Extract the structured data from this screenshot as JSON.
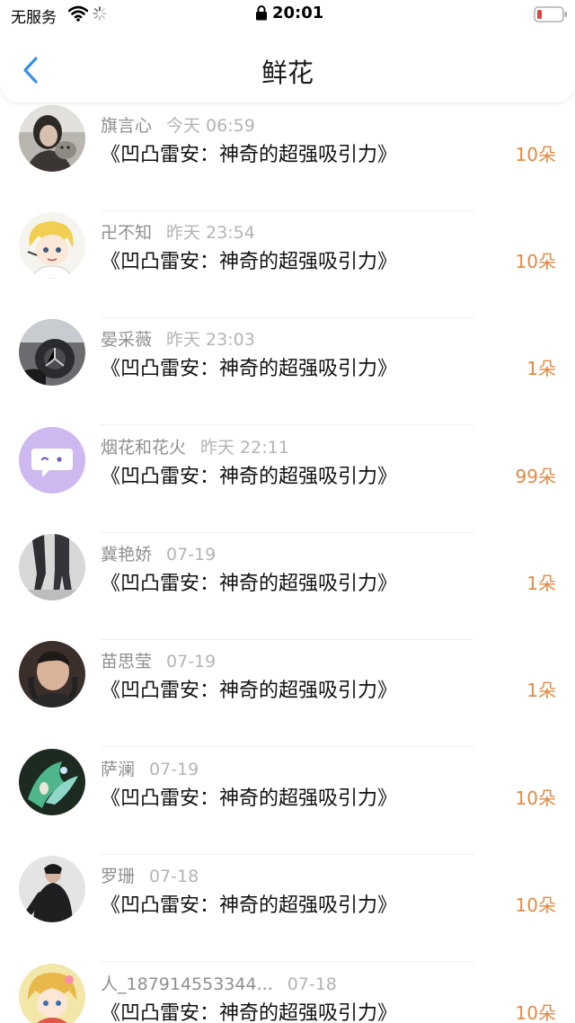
{
  "status_bar": {
    "carrier": "无服务",
    "time": "20:01",
    "battery_color": "#e04040"
  },
  "nav": {
    "title": "鲜花",
    "back_icon": "chevron-left-icon",
    "accent_color": "#3a8ee6"
  },
  "items": [
    {
      "name": "旗言心",
      "time": "今天 06:59",
      "title": "《凹凸雷安：神奇的超强吸引力》",
      "count": "10朵"
    },
    {
      "name": "卍不知",
      "time": "昨天 23:54",
      "title": "《凹凸雷安：神奇的超强吸引力》",
      "count": "10朵"
    },
    {
      "name": "晏采薇",
      "time": "昨天 23:03",
      "title": "《凹凸雷安：神奇的超强吸引力》",
      "count": "1朵"
    },
    {
      "name": "烟花和花火",
      "time": "昨天 22:11",
      "title": "《凹凸雷安：神奇的超强吸引力》",
      "count": "99朵"
    },
    {
      "name": "冀艳娇",
      "time": "07-19",
      "title": "《凹凸雷安：神奇的超强吸引力》",
      "count": "1朵"
    },
    {
      "name": "苗思莹",
      "time": "07-19",
      "title": "《凹凸雷安：神奇的超强吸引力》",
      "count": "1朵"
    },
    {
      "name": "萨澜",
      "time": "07-19",
      "title": "《凹凸雷安：神奇的超强吸引力》",
      "count": "10朵"
    },
    {
      "name": "罗珊",
      "time": "07-18",
      "title": "《凹凸雷安：神奇的超强吸引力》",
      "count": "10朵"
    },
    {
      "name": "人_187914553344...",
      "time": "07-18",
      "title": "《凹凸雷安：神奇的超强吸引力》",
      "count": "10朵"
    }
  ]
}
